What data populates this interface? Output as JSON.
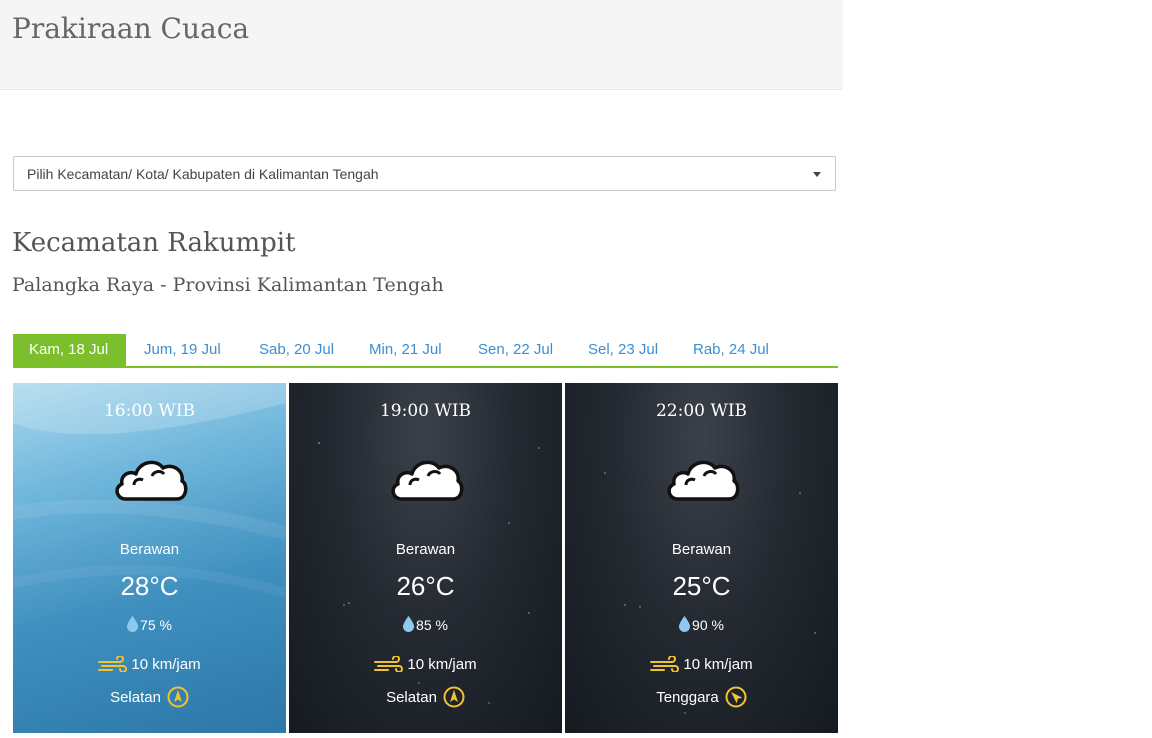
{
  "header": {
    "title": "Prakiraan Cuaca"
  },
  "location_select": {
    "placeholder": "Pilih Kecamatan/ Kota/ Kabupaten di Kalimantan Tengah"
  },
  "location": {
    "title": "Kecamatan Rakumpit",
    "subtitle": "Palangka Raya - Provinsi Kalimantan Tengah"
  },
  "tabs": [
    {
      "label": "Kam, 18 Jul",
      "active": true
    },
    {
      "label": "Jum, 19 Jul",
      "active": false
    },
    {
      "label": "Sab, 20 Jul",
      "active": false
    },
    {
      "label": "Min, 21 Jul",
      "active": false
    },
    {
      "label": "Sen, 22 Jul",
      "active": false
    },
    {
      "label": "Sel, 23 Jul",
      "active": false
    },
    {
      "label": "Rab, 24 Jul",
      "active": false
    }
  ],
  "colors": {
    "accent": "#7cbf2d",
    "link": "#3b8fd0",
    "wind_icon": "#f2c230",
    "drop_icon": "#8ec9f2"
  },
  "forecasts": [
    {
      "time": "16:00 WIB",
      "icon": "cloud-icon",
      "condition": "Berawan",
      "temperature": "28°C",
      "humidity": "75 %",
      "wind_speed": "10 km/jam",
      "wind_direction": "Selatan",
      "theme": "day"
    },
    {
      "time": "19:00 WIB",
      "icon": "cloud-icon",
      "condition": "Berawan",
      "temperature": "26°C",
      "humidity": "85 %",
      "wind_speed": "10 km/jam",
      "wind_direction": "Selatan",
      "theme": "night"
    },
    {
      "time": "22:00 WIB",
      "icon": "cloud-icon",
      "condition": "Berawan",
      "temperature": "25°C",
      "humidity": "90 %",
      "wind_speed": "10 km/jam",
      "wind_direction": "Tenggara",
      "theme": "night"
    }
  ]
}
